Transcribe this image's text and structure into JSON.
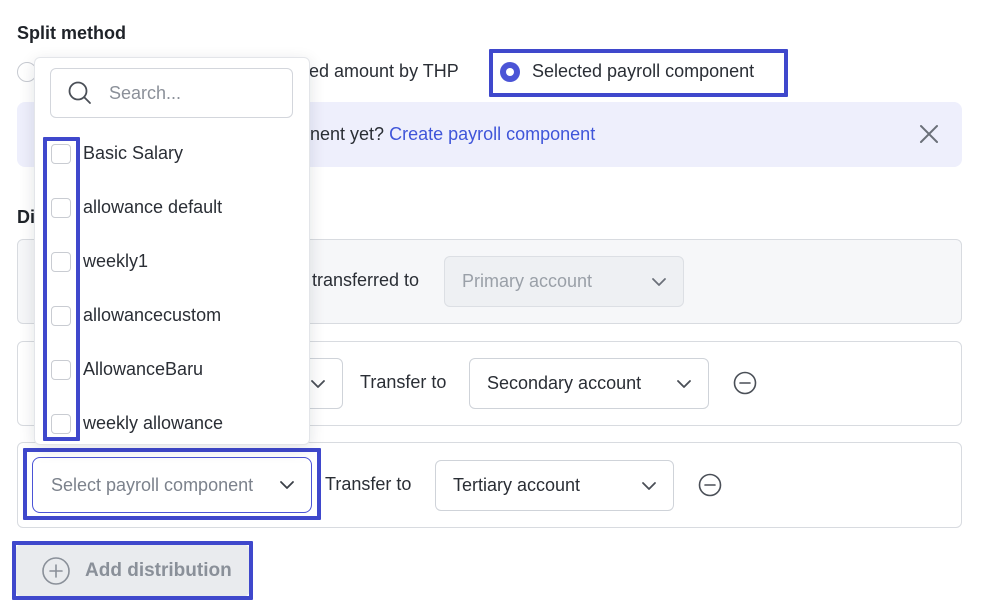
{
  "split_method": {
    "title": "Split method",
    "option_thp_label": "ed amount by THP",
    "option_component_label": "Selected payroll component"
  },
  "banner": {
    "text": "nent yet?",
    "link_label": "Create payroll component"
  },
  "distribution": {
    "title_partial": "Di",
    "rows": [
      {
        "transfer_label": "transferred to",
        "account": "Primary account"
      },
      {
        "transfer_label": "Transfer to",
        "account": "Secondary account"
      },
      {
        "component_placeholder": "Select payroll component",
        "transfer_label": "Transfer to",
        "account": "Tertiary account"
      }
    ],
    "add_label": "Add distribution"
  },
  "dropdown": {
    "search_placeholder": "Search...",
    "options": [
      "Basic Salary",
      "allowance default",
      "weekly1",
      "allowancecustom",
      "AllowanceBaru",
      "weekly allowance"
    ]
  },
  "colors": {
    "accent": "#4b54d6",
    "highlight": "#3f48cc",
    "link": "#3f55d9",
    "banner_bg": "#eeeffc"
  }
}
